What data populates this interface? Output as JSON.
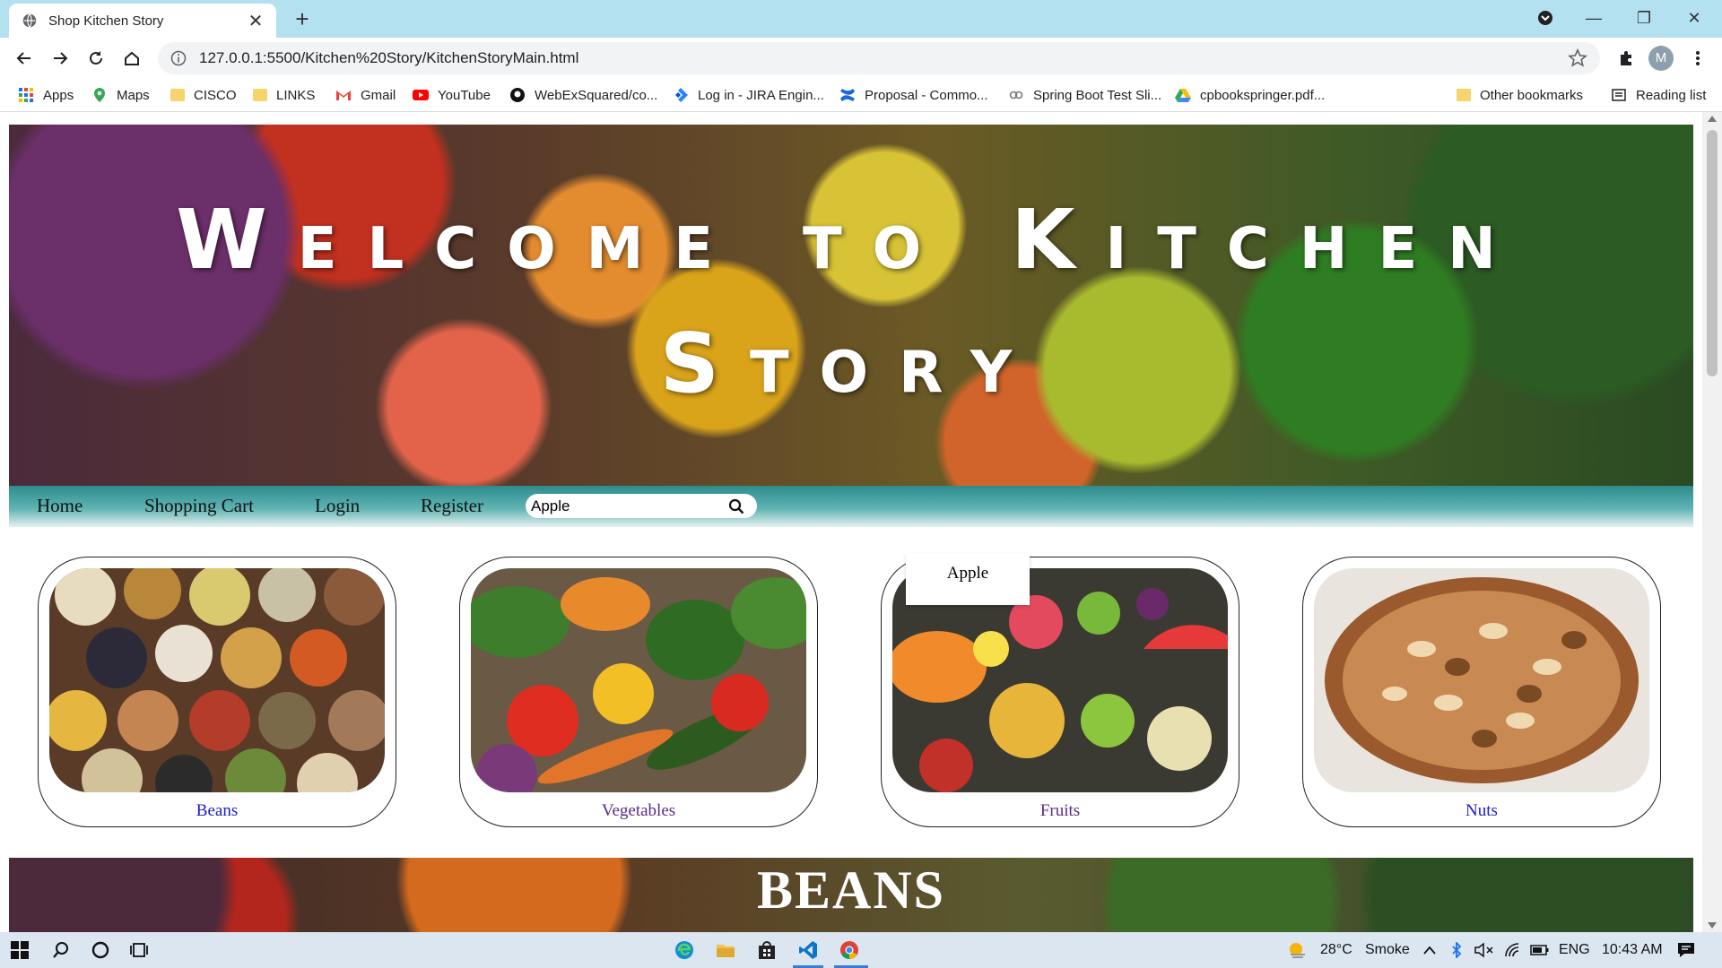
{
  "browser": {
    "tab_title": "Shop Kitchen Story",
    "url": "127.0.0.1:5500/Kitchen%20Story/KitchenStoryMain.html",
    "profile_initial": "M",
    "bookmarks": [
      "Apps",
      "Maps",
      "CISCO",
      "LINKS",
      "Gmail",
      "YouTube",
      "WebExSquared/co...",
      "Log in - JIRA Engin...",
      "Proposal - Commo...",
      "Spring Boot Test Sli...",
      "cpbookspringer.pdf..."
    ],
    "other_bookmarks": "Other bookmarks",
    "reading_list": "Reading list"
  },
  "page": {
    "hero_title": "Welcome to Kitchen Story",
    "nav": [
      "Home",
      "Shopping Cart",
      "Login",
      "Register"
    ],
    "search": {
      "value": "Apple"
    },
    "search_suggestion": "Apple",
    "categories": [
      "Beans",
      "Vegetables",
      "Fruits",
      "Nuts"
    ],
    "section_title": "BEANS",
    "colors": {
      "nav_teal": "#2e8c8d",
      "link_blue": "#1a1acc",
      "link_visited": "#5a2a86"
    }
  },
  "taskbar": {
    "temperature": "28°C",
    "weather": "Smoke",
    "language": "ENG",
    "time": "10:43 AM"
  }
}
